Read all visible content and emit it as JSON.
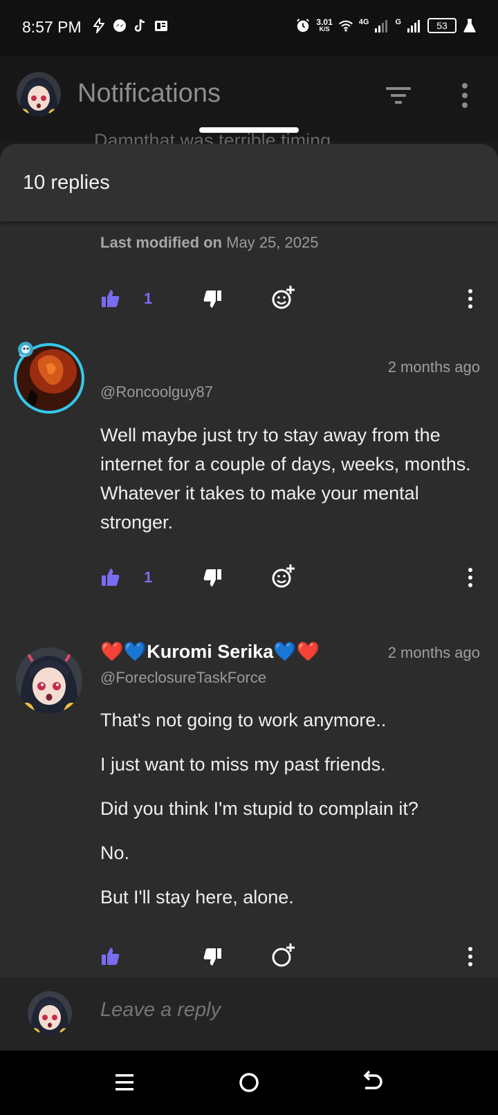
{
  "status_bar": {
    "time": "8:57 PM",
    "net_speed_value": "3.01",
    "net_speed_unit": "K/S",
    "network_4g": "4G",
    "network_g": "G",
    "battery": "53"
  },
  "app_bar": {
    "title": "Notifications",
    "peek_text": "Damnthat was terrible timing"
  },
  "sheet": {
    "replies_count": "10 replies"
  },
  "comments": [
    {
      "last_modified_label": "Last modified on",
      "last_modified_date": "May 25, 2025",
      "likes": "1"
    },
    {
      "time_ago": "2 months ago",
      "handle": "@Roncoolguy87",
      "body": "Well maybe just try to stay away from the internet for a couple of days, weeks, months. Whatever it takes to make your mental stronger.",
      "likes": "1"
    },
    {
      "author": "❤️💙Kuromi Serika💙❤️",
      "time_ago": "2 months ago",
      "handle": "@ForeclosureTaskForce",
      "paragraphs": [
        "That's not going to work anymore..",
        "I just want to miss my past friends.",
        "Did you think I'm stupid to complain it?",
        "No.",
        "But I'll stay here, alone."
      ]
    }
  ],
  "composer": {
    "placeholder": "Leave a reply"
  },
  "colors": {
    "accent": "#7a6cf0",
    "sheet_bg": "#2b2c2b",
    "ring": "#35c8ec"
  }
}
